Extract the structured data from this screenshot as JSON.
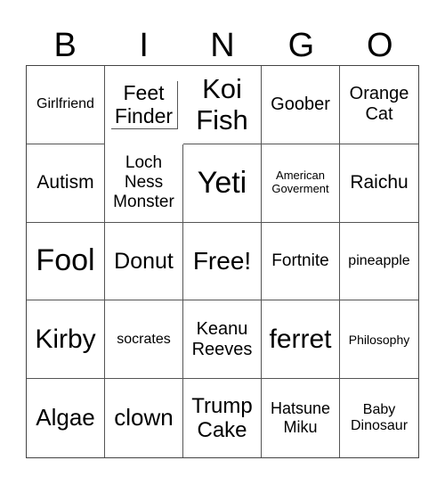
{
  "title_letters": [
    "B",
    "I",
    "N",
    "G",
    "O"
  ],
  "cells": [
    "Girlfriend",
    "Feet Finder",
    "Koi Fish",
    "Goober",
    "Orange Cat",
    "Autism",
    "Loch Ness Monster",
    "Yeti",
    "American Goverment",
    "Raichu",
    "Fool",
    "Donut",
    "Free!",
    "Fortnite",
    "pineapple",
    "Kirby",
    "socrates",
    "Keanu Reeves",
    "ferret",
    "Philosophy",
    "Algae",
    "clown",
    "Trump Cake",
    "Hatsune Miku",
    "Baby Dinosaur"
  ]
}
